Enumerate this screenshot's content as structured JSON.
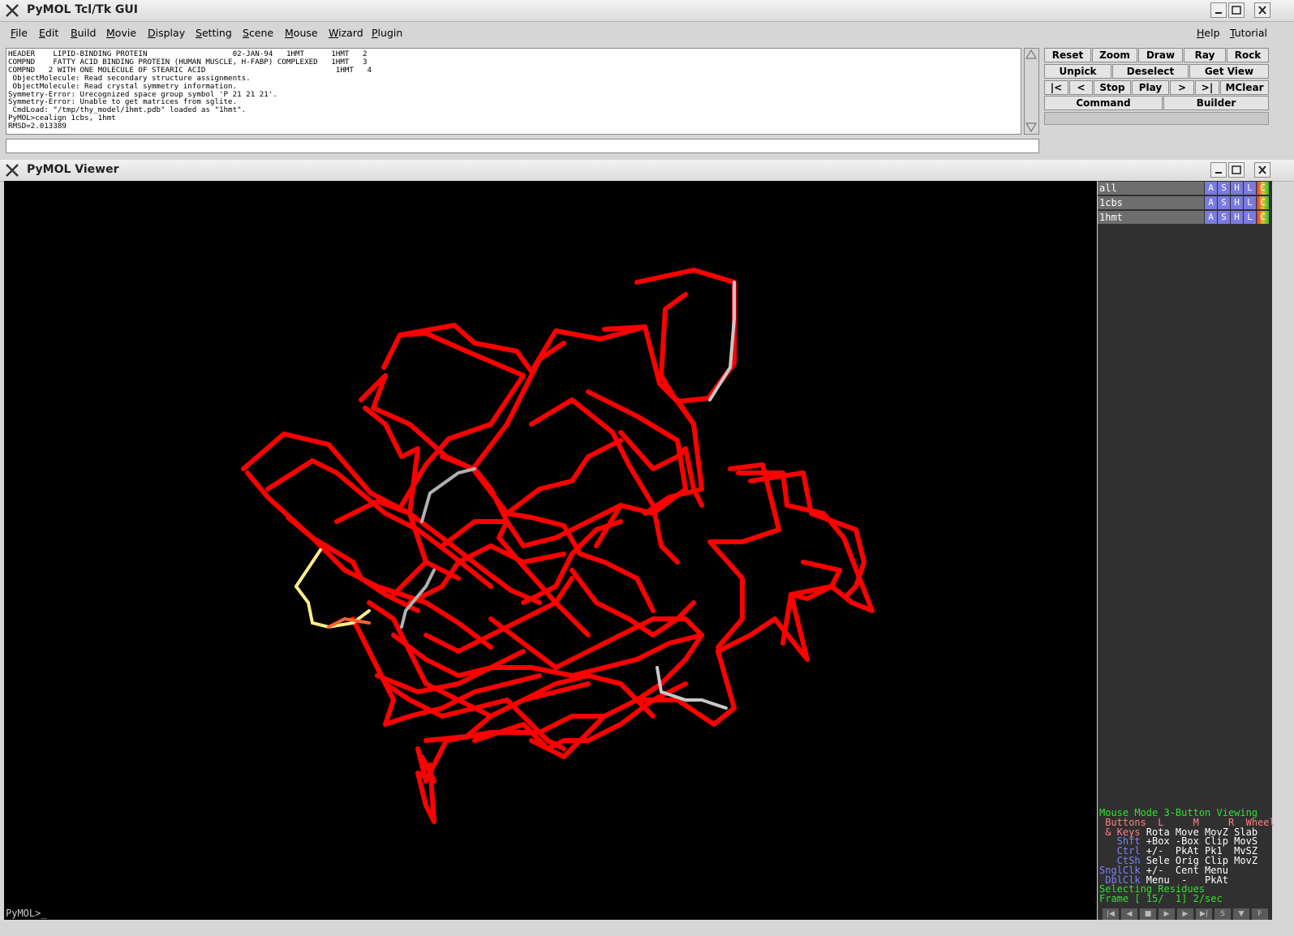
{
  "gui_window": {
    "title": "PyMOL Tcl/Tk GUI"
  },
  "menubar": {
    "items": [
      "File",
      "Edit",
      "Build",
      "Movie",
      "Display",
      "Setting",
      "Scene",
      "Mouse",
      "Wizard",
      "Plugin"
    ],
    "right_items": [
      "Help",
      "Tutorial"
    ]
  },
  "log": {
    "lines": [
      "HEADER    LIPID-BINDING PROTEIN                   02-JAN-94   1HMT      1HMT   2",
      "COMPND    FATTY ACID BINDING PROTEIN (HUMAN MUSCLE, H-FABP) COMPLEXED   1HMT   3",
      "COMPND   2 WITH ONE MOLECULE OF STEARIC ACID                             1HMT   4",
      " ObjectMolecule: Read secondary structure assignments.",
      " ObjectMolecule: Read crystal symmetry information.",
      "Symmetry-Error: Urecognized space group symbol 'P 21 21 21'.",
      "Symmetry-Error: Unable to get matrices from sglite.",
      " CmdLoad: \"/tmp/thy_model/1hmt.pdb\" loaded as \"1hmt\".",
      "PyMOL>cealign 1cbs, 1hmt",
      "RMSD=2.013389"
    ]
  },
  "controls": {
    "row1": [
      "Reset",
      "Zoom",
      "Draw",
      "Ray",
      "Rock"
    ],
    "row2": [
      "Unpick",
      "Deselect",
      "Get View"
    ],
    "row3": [
      "|<",
      "<",
      "Stop",
      "Play",
      ">",
      ">|",
      "MClear"
    ],
    "row4": [
      "Command",
      "Builder"
    ]
  },
  "viewer_window": {
    "title": "PyMOL Viewer"
  },
  "objects": [
    {
      "name": "all",
      "buttons": [
        "A",
        "S",
        "H",
        "L",
        "C"
      ]
    },
    {
      "name": "1cbs",
      "buttons": [
        "A",
        "S",
        "H",
        "L",
        "C"
      ]
    },
    {
      "name": "1hmt",
      "buttons": [
        "A",
        "S",
        "H",
        "L",
        "C"
      ]
    }
  ],
  "mouse_help": {
    "mode_line": "Mouse Mode 3-Button Viewing",
    "buttons_header": " Buttons  L     M     R  Wheel",
    "rows": [
      {
        "label": " & Keys",
        "values": " Rota Move MovZ Slab"
      },
      {
        "label": "   Shft",
        "values": " +Box -Box Clip MovS"
      },
      {
        "label": "   Ctrl",
        "values": " +/-  PkAt Pk1  MvSZ"
      },
      {
        "label": "   CtSh",
        "values": " Sele Orig Clip MovZ"
      },
      {
        "label": "SnglClk",
        "values": " +/-  Cent Menu"
      },
      {
        "label": " DblClk",
        "values": " Menu  -   PkAt"
      }
    ],
    "selecting": "Selecting Residues",
    "frame": "Frame [ 15/  1] 2/sec"
  },
  "prompt": "PyMOL>_",
  "transport": [
    "|◀",
    "◀",
    "■",
    "▶",
    "▶",
    "▶|",
    "S",
    "▼",
    "F"
  ],
  "colors": {
    "backbone": "#ff0000",
    "background": "#000000",
    "unaligned": "#c8c8c8",
    "highlight": "#ffee88"
  }
}
